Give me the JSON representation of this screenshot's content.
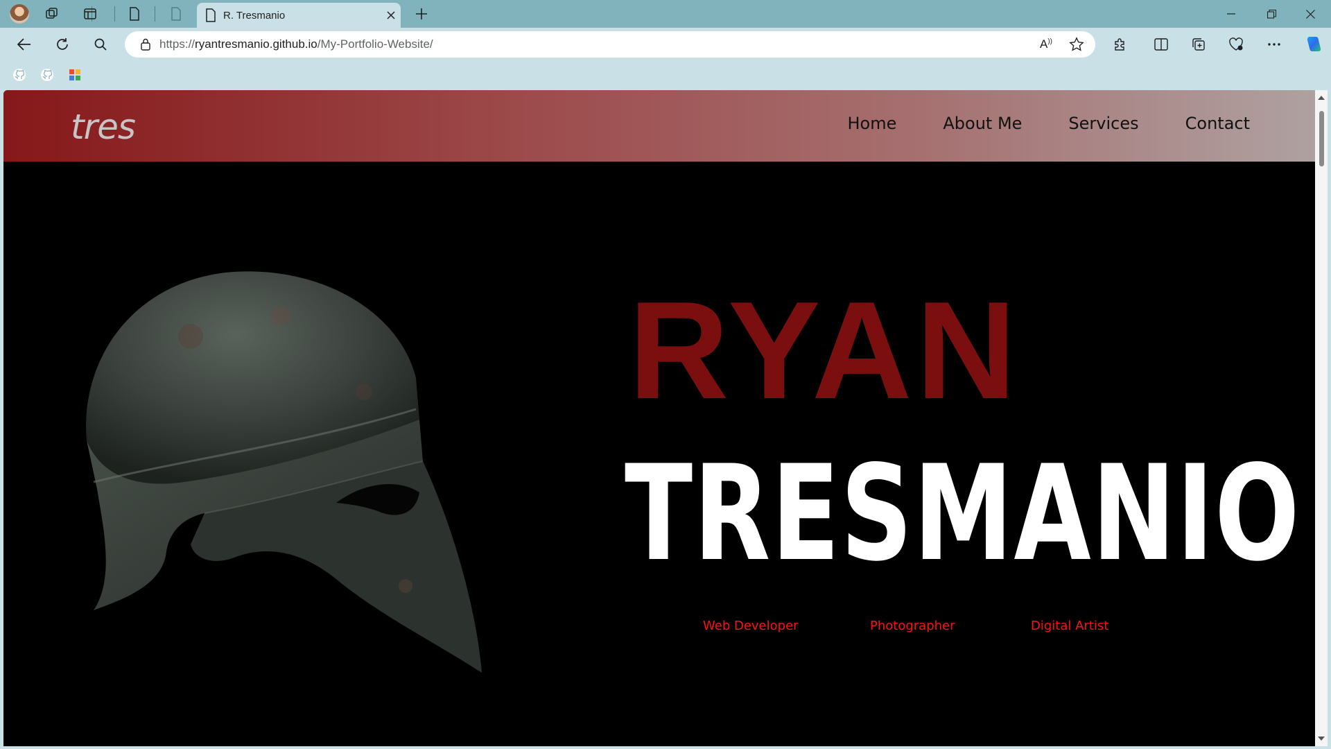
{
  "browser": {
    "tab_title": "R. Tresmanio",
    "url_prefix": "https://",
    "url_host": "ryantresmanio.github.io",
    "url_path": "/My-Portfolio-Website/"
  },
  "site": {
    "logo": "tres",
    "nav": [
      "Home",
      "About Me",
      "Services",
      "Contact"
    ],
    "first_name": "RYAN",
    "last_name": "TRESMANIO",
    "roles": [
      "Web Developer",
      "Photographer",
      "Digital Artist"
    ]
  },
  "colors": {
    "tabbar": "#80b3bb",
    "toolbar": "#c9e1e6",
    "header_start": "#861819",
    "header_end": "#afa1a1",
    "first_name": "#7b0f10",
    "roles": "#ff1010"
  }
}
